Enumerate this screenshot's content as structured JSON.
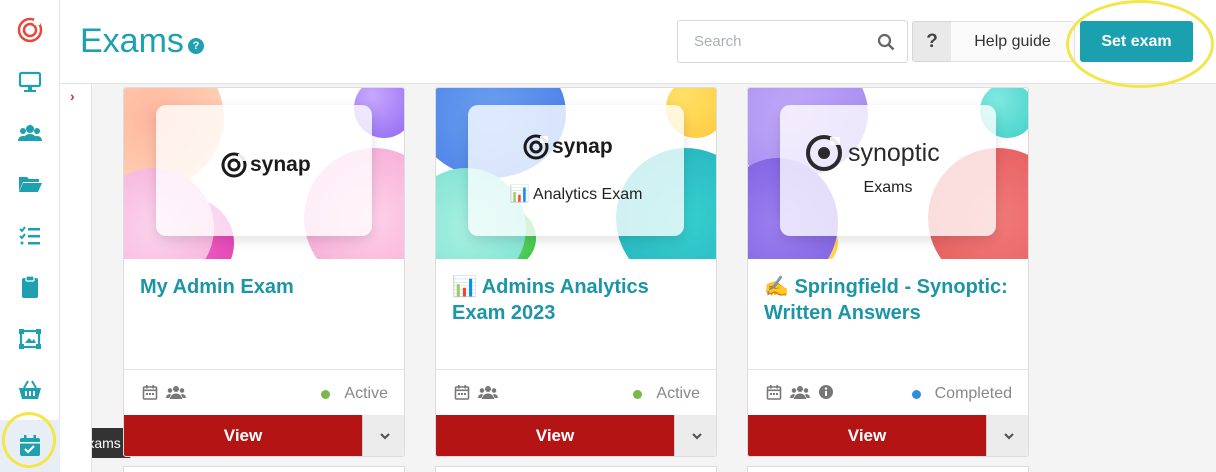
{
  "header": {
    "title": "Exams",
    "search_placeholder": "Search",
    "help_q": "?",
    "help_guide": "Help guide",
    "set_exam": "Set exam"
  },
  "sidebar": {
    "items": [
      {
        "icon": "synap-logo-icon"
      },
      {
        "icon": "monitor-icon"
      },
      {
        "icon": "users-icon"
      },
      {
        "icon": "folder-icon"
      },
      {
        "icon": "checklist-icon"
      },
      {
        "icon": "clipboard-icon"
      },
      {
        "icon": "image-frame-icon"
      },
      {
        "icon": "basket-icon"
      },
      {
        "icon": "calendar-check-icon"
      }
    ],
    "tooltip": "Exams",
    "accent": "#1ea0b1"
  },
  "cards": [
    {
      "logo_text": "synap",
      "sub": "",
      "title": "My Admin Exam",
      "status": "Active",
      "status_color": "#7ab648",
      "view": "View"
    },
    {
      "logo_text": "synap",
      "sub": "📊 Analytics Exam",
      "title": "📊 Admins Analytics Exam 2023",
      "status": "Active",
      "status_color": "#7ab648",
      "view": "View"
    },
    {
      "logo_text": "synoptic",
      "sub": "Exams",
      "title": "✍️ Springfield - Synoptic: Written Answers",
      "status": "Completed",
      "status_color": "#2d8fd5",
      "view": "View"
    }
  ],
  "colors": {
    "primary": "#1ba0b0",
    "view_button": "#b51414",
    "title": "#1c95a6"
  }
}
